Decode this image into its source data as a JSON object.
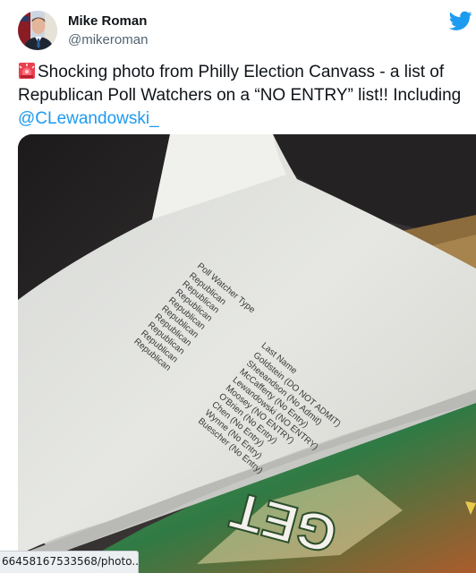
{
  "author": {
    "name": "Mike Roman",
    "handle": "@mikeroman"
  },
  "tweet": {
    "text_main": "Shocking photo from Philly Election Canvass - a list of Republican Poll Watchers on a “NO ENTRY” list!! Including ",
    "mention": "@CLewandowski_"
  },
  "photo": {
    "header_left": "Poll Watcher Type",
    "header_right": "Last Name",
    "types": [
      "Republican",
      "Republican",
      "Republican",
      "Republican",
      "Republican",
      "Republican",
      "Republican",
      "Republican",
      "Republican"
    ],
    "names": [
      "Goldstein (DO NOT ADMIT)",
      "Sheeandson (No Admit)",
      "McCafferty (No Entry)",
      "Lewandowski (NO ENTRY)",
      "Moosey (NO ENTRY)",
      "O'Brien (No Entry)",
      "Chen (No Entry)",
      "Wynne (No Entry)",
      "Buescher (No Entry)"
    ],
    "bag_text": "GET"
  },
  "status_bar": {
    "url": "66458167533568/photo..."
  },
  "colors": {
    "link": "#1d9bf0",
    "twitter_blue": "#1d9bf0",
    "text": "#0f1419",
    "secondary": "#536471"
  },
  "icons": [
    "avatar",
    "twitter-bird-icon",
    "siren-icon"
  ]
}
